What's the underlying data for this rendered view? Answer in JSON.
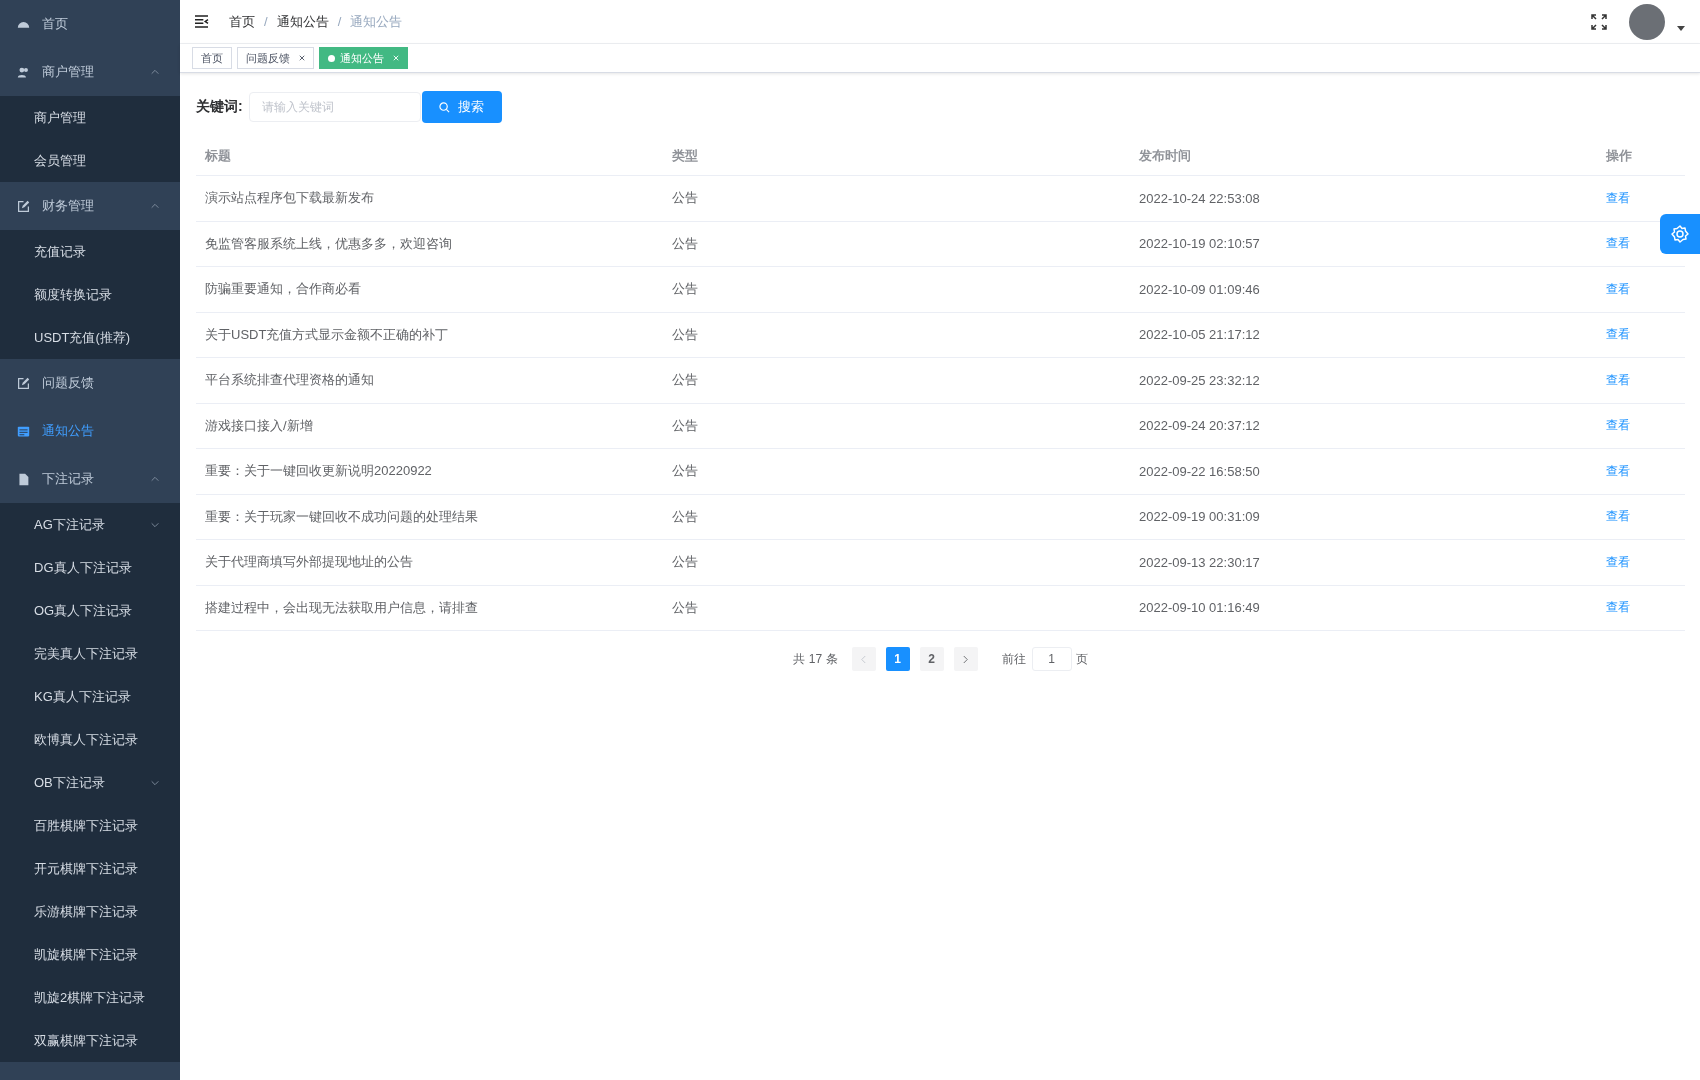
{
  "sidebar": {
    "items": [
      {
        "label": "首页",
        "selected": false
      },
      {
        "label": "商户管理",
        "selected": false,
        "expanded": true,
        "children": [
          {
            "label": "商户管理",
            "selected": false
          },
          {
            "label": "会员管理",
            "selected": false
          }
        ]
      },
      {
        "label": "财务管理",
        "selected": false,
        "expanded": true,
        "children": [
          {
            "label": "充值记录",
            "selected": false
          },
          {
            "label": "额度转换记录",
            "selected": false
          },
          {
            "label": "USDT充值(推荐)",
            "selected": false
          }
        ]
      },
      {
        "label": "问题反馈",
        "selected": false
      },
      {
        "label": "通知公告",
        "selected": true
      },
      {
        "label": "下注记录",
        "selected": false,
        "expanded": true,
        "children": [
          {
            "label": "AG下注记录",
            "selected": false,
            "expanded": false
          },
          {
            "label": "DG真人下注记录",
            "selected": false
          },
          {
            "label": "OG真人下注记录",
            "selected": false
          },
          {
            "label": "完美真人下注记录",
            "selected": false
          },
          {
            "label": "KG真人下注记录",
            "selected": false
          },
          {
            "label": "欧博真人下注记录",
            "selected": false
          },
          {
            "label": "OB下注记录",
            "selected": false,
            "expanded": false
          },
          {
            "label": "百胜棋牌下注记录",
            "selected": false
          },
          {
            "label": "开元棋牌下注记录",
            "selected": false
          },
          {
            "label": "乐游棋牌下注记录",
            "selected": false
          },
          {
            "label": "凯旋棋牌下注记录",
            "selected": false
          },
          {
            "label": "凯旋2棋牌下注记录",
            "selected": false
          },
          {
            "label": "双赢棋牌下注记录",
            "selected": false
          }
        ]
      }
    ]
  },
  "breadcrumb": [
    "首页",
    "通知公告",
    "通知公告"
  ],
  "breadcrumb_separator": "/",
  "tabs": [
    {
      "label": "首页",
      "selected": false,
      "closable": false
    },
    {
      "label": "问题反馈",
      "selected": false,
      "closable": true
    },
    {
      "label": "通知公告",
      "selected": true,
      "closable": true
    }
  ],
  "search": {
    "label": "关键词:",
    "placeholder": "请输入关键词",
    "button": "搜索"
  },
  "table": {
    "columns": [
      "标题",
      "类型",
      "发布时间",
      "操作"
    ],
    "rows": [
      {
        "title": "演示站点程序包下载最新发布",
        "type": "公告",
        "time": "2022-10-24 22:53:08",
        "action": "查看"
      },
      {
        "title": "免监管客服系统上线，优惠多多，欢迎咨询",
        "type": "公告",
        "time": "2022-10-19 02:10:57",
        "action": "查看"
      },
      {
        "title": "防骗重要通知，合作商必看",
        "type": "公告",
        "time": "2022-10-09 01:09:46",
        "action": "查看"
      },
      {
        "title": "关于USDT充值方式显示金额不正确的补丁",
        "type": "公告",
        "time": "2022-10-05 21:17:12",
        "action": "查看"
      },
      {
        "title": "平台系统排查代理资格的通知",
        "type": "公告",
        "time": "2022-09-25 23:32:12",
        "action": "查看"
      },
      {
        "title": "游戏接口接入/新增",
        "type": "公告",
        "time": "2022-09-24 20:37:12",
        "action": "查看"
      },
      {
        "title": "重要：关于一键回收更新说明20220922",
        "type": "公告",
        "time": "2022-09-22 16:58:50",
        "action": "查看"
      },
      {
        "title": "重要：关于玩家一键回收不成功问题的处理结果",
        "type": "公告",
        "time": "2022-09-19 00:31:09",
        "action": "查看"
      },
      {
        "title": "关于代理商填写外部提现地址的公告",
        "type": "公告",
        "time": "2022-09-13 22:30:17",
        "action": "查看"
      },
      {
        "title": "搭建过程中，会出现无法获取用户信息，请排查",
        "type": "公告",
        "time": "2022-09-10 01:16:49",
        "action": "查看"
      }
    ]
  },
  "pagination": {
    "total": "共 17 条",
    "prev_disabled": true,
    "pages": [
      {
        "label": "1",
        "selected": true
      },
      {
        "label": "2",
        "selected": false
      }
    ],
    "goto": "前往",
    "page_value": "1",
    "page_unit": "页"
  }
}
